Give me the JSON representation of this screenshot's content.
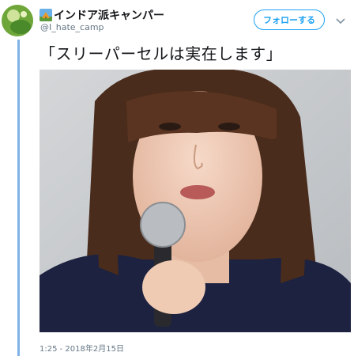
{
  "user": {
    "display_name": "インドア派キャンパー",
    "handle": "@I_hate_camp",
    "name_emoji_icon": "camping-tent-emoji-icon",
    "avatar_icon": "green-avatar"
  },
  "actions": {
    "follow_label": "フォローする",
    "menu_icon": "chevron-down-icon"
  },
  "tweet": {
    "text": "「スリーパーセルは実在します」",
    "timestamp": "1:25 - 2018年2月15日"
  },
  "colors": {
    "accent": "#1da1f2",
    "thread_rule": "#7fb2e6",
    "muted": "#657786"
  }
}
